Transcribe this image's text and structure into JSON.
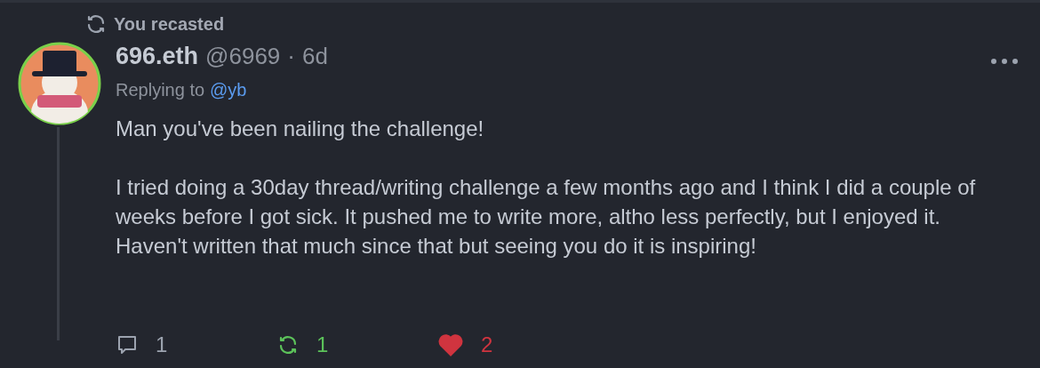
{
  "recast_header": {
    "label": "You recasted"
  },
  "post": {
    "author_name": "696.eth",
    "handle": "@6969",
    "separator": "·",
    "age": "6d",
    "replying_to_label": "Replying to",
    "replying_to_handle": "@yb",
    "paragraphs": [
      "Man you've been nailing the challenge!",
      "I tried doing a 30day thread/writing challenge a few months ago and I think I did a couple of weeks before I got sick. It pushed me to write more, altho less perfectly, but I enjoyed it. Haven't written that much since that but seeing you do it is inspiring!"
    ]
  },
  "actions": [
    {
      "kind": "reply",
      "count": "1",
      "selected": false
    },
    {
      "kind": "recast",
      "count": "1",
      "selected": true
    },
    {
      "kind": "like",
      "count": "2",
      "selected": true
    }
  ]
}
